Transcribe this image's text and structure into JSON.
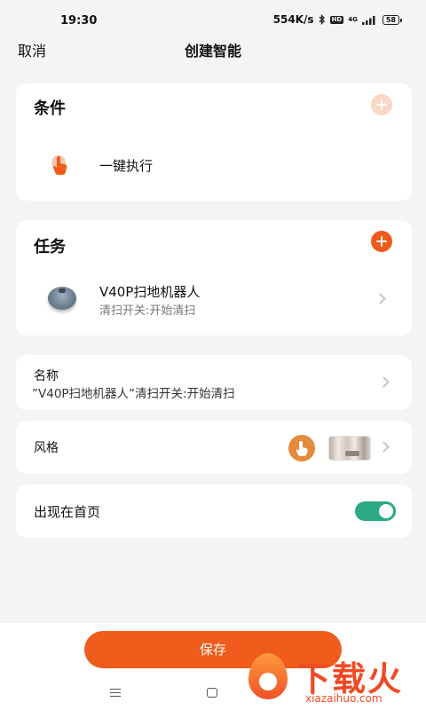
{
  "status_bar": {
    "time": "19:30",
    "net_speed": "554K/s",
    "hd": "HD",
    "network": "4G",
    "battery": "58"
  },
  "nav": {
    "cancel_label": "取消",
    "title": "创建智能"
  },
  "conditions": {
    "title": "条件",
    "item_label": "一键执行"
  },
  "tasks": {
    "title": "任务",
    "device_name": "V40P扫地机器人",
    "device_action": "清扫开关:开始清扫"
  },
  "name_row": {
    "label": "名称",
    "value": "”V40P扫地机器人”清扫开关:开始清扫"
  },
  "style_row": {
    "label": "风格"
  },
  "homepage_row": {
    "label": "出现在首页",
    "enabled": true
  },
  "save_label": "保存",
  "watermark": {
    "title": "下载火",
    "url": "xiazaihuo.com"
  },
  "colors": {
    "accent": "#ef5c1c",
    "toggle_on": "#2aa982",
    "add_light": "#fbd7c5"
  }
}
